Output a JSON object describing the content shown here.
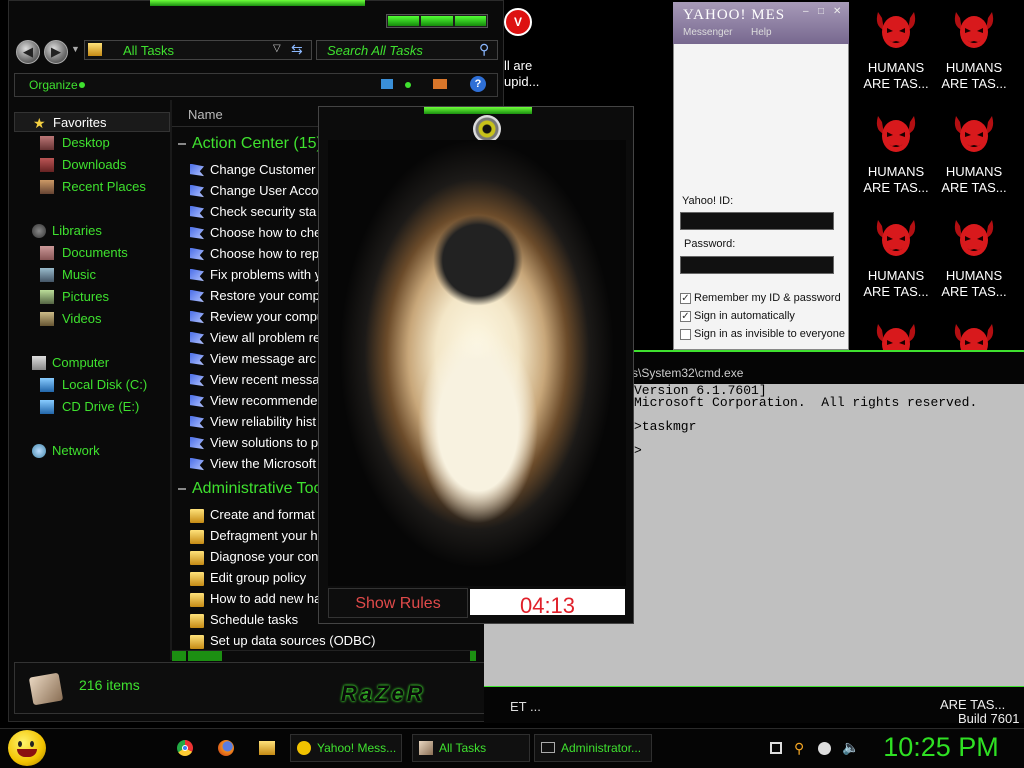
{
  "explorer": {
    "address": "All Tasks",
    "search_placeholder": "Search All Tasks",
    "organize": "Organize",
    "column_name": "Name",
    "nav": {
      "favorites": "Favorites",
      "desktop": "Desktop",
      "downloads": "Downloads",
      "recent_places": "Recent Places",
      "libraries": "Libraries",
      "documents": "Documents",
      "music": "Music",
      "pictures": "Pictures",
      "videos": "Videos",
      "computer": "Computer",
      "local_disk": "Local Disk (C:)",
      "cd_drive": "CD Drive (E:)",
      "network": "Network"
    },
    "group1": "Action Center (15)",
    "group1_items": [
      "Change Customer",
      "Change User Acco",
      "Check security sta",
      "Choose how to che",
      "Choose how to rep",
      "Fix problems with y",
      "Restore your comp",
      "Review your compu",
      "View all problem re",
      "View message arc",
      "View recent messa",
      "View recommende",
      "View reliability hist",
      "View solutions to p",
      "View the Microsoft"
    ],
    "group2": "Administrative Too",
    "group2_items": [
      "Create and format",
      "Defragment your ha",
      "Diagnose your con",
      "Edit group policy",
      "How to add new ha",
      "Schedule tasks",
      "Set up data sources (ODBC)"
    ],
    "status_count": "216 items",
    "brand": "RaZeR"
  },
  "game": {
    "show_rules": "Show Rules",
    "timer": "04:13"
  },
  "yahoo": {
    "brand": "YAHOO! MES",
    "menu_messenger": "Messenger",
    "menu_help": "Help",
    "id_label": "Yahoo! ID:",
    "password_label": "Password:",
    "remember": "Remember my ID & password",
    "remember_checked": true,
    "auto_signin": "Sign in automatically",
    "auto_signin_checked": true,
    "invisible": "Sign in as invisible to everyone",
    "invisible_checked": false
  },
  "cmd": {
    "title": "s\\System32\\cmd.exe",
    "lines": [
      "Version 6.1.7601]",
      "Microsoft Corporation.  All rights reserved.",
      "",
      ">taskmgr",
      "",
      ">"
    ],
    "bottom_left": "ET ...",
    "bottom_right1": "ARE TAS...",
    "bottom_right2": "Build 7601"
  },
  "desktop": {
    "partial_text1": "ll are",
    "partial_text2": "upid...",
    "icon_label_line1": "HUMANS",
    "icon_label_line2": "ARE TAS..."
  },
  "taskbar": {
    "yahoo_task": "Yahoo! Mess...",
    "all_tasks": "All Tasks",
    "admin": "Administrator...",
    "clock": "10:25 PM"
  },
  "colors": {
    "accent_green": "#3fe12f",
    "timer_red": "#e0202a",
    "rules_red": "#e04a4a"
  }
}
